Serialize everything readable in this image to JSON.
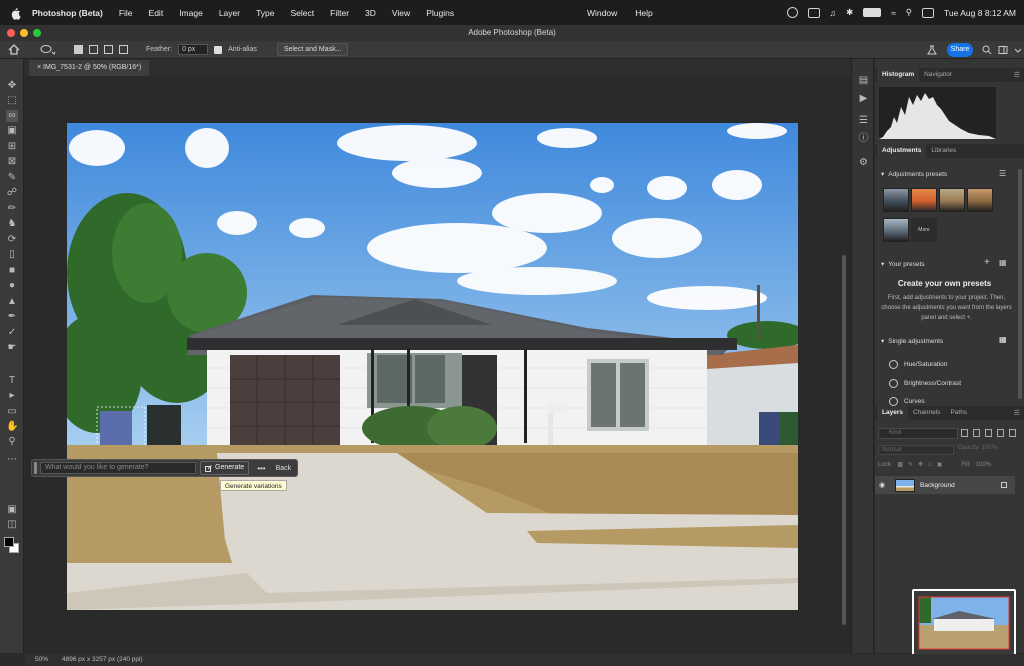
{
  "menubar": {
    "app_name": "Photoshop (Beta)",
    "items": [
      "File",
      "Edit",
      "Image",
      "Layer",
      "Type",
      "Select",
      "Filter",
      "3D",
      "View",
      "Plugins"
    ],
    "mid_items": [
      "Window",
      "Help"
    ],
    "datetime": "Tue Aug 8  8:12 AM"
  },
  "window": {
    "title": "Adobe Photoshop (Beta)"
  },
  "options": {
    "feather_label": "Feather:",
    "feather_value": "0 px",
    "antialias_label": "Anti-alias",
    "select_mask_label": "Select and Mask...",
    "share_label": "Share"
  },
  "document": {
    "tab_title": "IMG_7531-2 @ 50% (RGB/16*)"
  },
  "context_bar": {
    "prompt_placeholder": "What would you like to generate?",
    "generate_label": "Generate",
    "more_label": "•••",
    "back_label": "Back",
    "tooltip": "Generate variations"
  },
  "panels": {
    "histogram_tabs": [
      "Histogram",
      "Navigator"
    ],
    "adjustments_tabs": [
      "Adjustments",
      "Libraries"
    ],
    "adjustment_presets": "Adjustments presets",
    "more_label": "More",
    "your_presets": "Your presets",
    "create_title": "Create your own presets",
    "create_text": "First, add adjustments to your project. Then, choose the adjustments you want from the layers panel and select +.",
    "single_adjustments": "Single adjustments",
    "adjustment_items": [
      "Hue/Saturation",
      "Brightness/Contrast",
      "Curves"
    ],
    "layers_tabs": [
      "Layers",
      "Channels",
      "Paths"
    ],
    "kind_placeholder": "Kind",
    "blend_mode": "Normal",
    "opacity_label": "Opacity:",
    "opacity_value": "100%",
    "lock_label": "Lock:",
    "fill_label": "Fill:",
    "fill_value": "100%",
    "layer_name": "Background"
  },
  "status": {
    "zoom": "50%",
    "info": "4896 px x 3257 px (240 ppi)"
  },
  "colors": {
    "accent": "#1473e6",
    "close": "#ff5f57",
    "minimize": "#febc2e",
    "zoom": "#28c840"
  }
}
